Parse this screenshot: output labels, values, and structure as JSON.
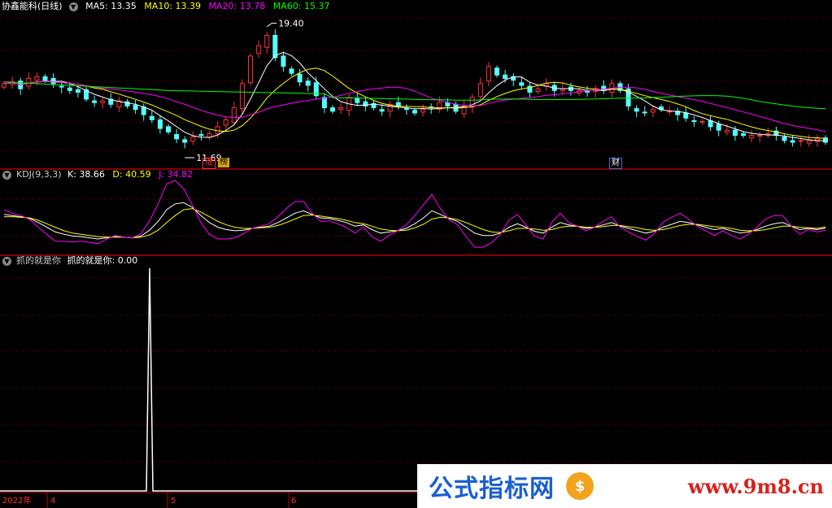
{
  "header_main": {
    "title": "协鑫能科(日线)",
    "ma5": "MA5: 13.35",
    "ma10": "MA10: 13.39",
    "ma20": "MA20: 13.78",
    "ma60": "MA60: 15.37"
  },
  "header_kdj": {
    "title": "KDJ(9,3,3)",
    "k": "K: 38.66",
    "d": "D: 40.59",
    "j": "J: 34.82"
  },
  "header_ind": {
    "title": "抓的就是你",
    "value": "抓的就是你: 0.00"
  },
  "annotations": {
    "high": "19.40",
    "low": "11.69",
    "badge_zhang": "涨",
    "badge_bang": "榜",
    "badge_cai": "财"
  },
  "x_axis": {
    "year": "2022年",
    "m4": "4",
    "m5": "5",
    "m6": "6"
  },
  "watermark": {
    "left": "公式指标网",
    "right": "www.9m8.cn",
    "logo": "$"
  },
  "colors": {
    "up": "#ff3232",
    "down": "#54ffff",
    "ma5": "#ffffff",
    "ma10": "#ffff00",
    "ma20": "#ff00ff",
    "ma60": "#00ff00",
    "grid": "#8b0000"
  },
  "chart_data": [
    {
      "type": "candlestick",
      "title": "协鑫能科(日线)",
      "price_high": 19.4,
      "price_low": 11.69,
      "close": [
        15.6,
        15.7,
        15.3,
        15.9,
        16.0,
        15.8,
        15.6,
        15.4,
        15.2,
        15.1,
        14.7,
        14.5,
        14.6,
        14.4,
        14.6,
        14.3,
        14.1,
        13.8,
        13.5,
        13.0,
        12.8,
        12.4,
        12.2,
        12.5,
        12.6,
        12.7,
        13.1,
        13.5,
        14.2,
        15.6,
        17.2,
        17.8,
        18.4,
        17.1,
        16.6,
        16.2,
        15.7,
        15.5,
        14.9,
        14.2,
        14.0,
        14.2,
        14.8,
        14.5,
        14.3,
        14.2,
        14.0,
        14.4,
        14.3,
        14.1,
        13.9,
        14.1,
        14.2,
        14.5,
        14.3,
        14.0,
        14.3,
        14.8,
        15.6,
        16.6,
        16.1,
        15.9,
        15.8,
        15.5,
        15.1,
        15.3,
        15.6,
        15.2,
        15.3,
        15.2,
        15.2,
        15.1,
        15.3,
        15.2,
        15.6,
        15.2,
        14.3,
        14.0,
        13.9,
        14.1,
        14.1,
        14.0,
        13.8,
        13.6,
        13.4,
        13.4,
        13.1,
        12.9,
        12.9,
        12.6,
        12.6,
        12.6,
        12.6,
        12.7,
        12.6,
        12.3,
        12.2,
        12.3,
        12.3,
        12.4,
        12.2
      ],
      "ma_labels": [
        "MA5",
        "MA10",
        "MA20",
        "MA60"
      ],
      "ma_values": [
        13.35,
        13.39,
        13.78,
        15.37
      ]
    },
    {
      "type": "line",
      "title": "KDJ(9,3,3)",
      "series": [
        {
          "name": "K",
          "values": [
            62,
            60,
            58,
            55,
            48,
            40,
            32,
            28,
            25,
            24,
            22,
            20,
            22,
            24,
            23,
            22,
            25,
            35,
            50,
            70,
            80,
            82,
            74,
            60,
            48,
            40,
            36,
            34,
            35,
            38,
            40,
            42,
            48,
            56,
            64,
            68,
            62,
            56,
            55,
            52,
            48,
            42,
            44,
            36,
            30,
            32,
            34,
            38,
            46,
            56,
            68,
            62,
            55,
            50,
            40,
            30,
            26,
            26,
            30,
            40,
            46,
            40,
            33,
            30,
            40,
            48,
            44,
            42,
            38,
            40,
            44,
            48,
            42,
            38,
            34,
            30,
            33,
            40,
            45,
            50,
            48,
            44,
            40,
            36,
            38,
            34,
            30,
            32,
            36,
            42,
            46,
            48,
            42,
            36,
            38,
            36,
            38.66
          ]
        },
        {
          "name": "D",
          "values": [
            58,
            58,
            57,
            56,
            52,
            46,
            40,
            34,
            30,
            28,
            26,
            24,
            23,
            23,
            23,
            22,
            23,
            27,
            35,
            48,
            60,
            70,
            72,
            66,
            58,
            50,
            44,
            40,
            38,
            38,
            39,
            40,
            43,
            48,
            54,
            60,
            61,
            59,
            57,
            55,
            52,
            48,
            46,
            42,
            37,
            35,
            34,
            35,
            39,
            45,
            54,
            57,
            56,
            53,
            48,
            42,
            36,
            32,
            31,
            34,
            38,
            38,
            37,
            35,
            36,
            40,
            42,
            42,
            40,
            40,
            41,
            43,
            43,
            41,
            39,
            36,
            35,
            36,
            39,
            43,
            45,
            45,
            43,
            41,
            40,
            38,
            35,
            34,
            34,
            36,
            39,
            42,
            42,
            40,
            39,
            38,
            40.59
          ]
        },
        {
          "name": "J",
          "values": [
            70,
            64,
            60,
            53,
            40,
            28,
            16,
            16,
            15,
            16,
            14,
            12,
            20,
            26,
            23,
            22,
            29,
            51,
            80,
            114,
            120,
            106,
            78,
            48,
            28,
            20,
            20,
            22,
            29,
            38,
            42,
            46,
            58,
            72,
            84,
            84,
            64,
            50,
            51,
            46,
            40,
            30,
            40,
            24,
            16,
            26,
            34,
            44,
            60,
            78,
            96,
            72,
            53,
            44,
            24,
            6,
            6,
            14,
            28,
            52,
            62,
            44,
            25,
            20,
            48,
            64,
            48,
            42,
            34,
            40,
            50,
            58,
            40,
            32,
            24,
            18,
            29,
            48,
            57,
            64,
            54,
            42,
            34,
            26,
            34,
            26,
            20,
            28,
            40,
            54,
            60,
            60,
            42,
            28,
            36,
            32,
            34.82
          ]
        }
      ]
    },
    {
      "type": "line",
      "title": "抓的就是你",
      "series": [
        {
          "name": "抓的就是你",
          "values": [
            0,
            0,
            0,
            0,
            0,
            0,
            0,
            0,
            0,
            0,
            0,
            0,
            0,
            0,
            0,
            0,
            0,
            0,
            0,
            0,
            0,
            0,
            0,
            1,
            0,
            0,
            0,
            0,
            0,
            0,
            0,
            0,
            0,
            0,
            0,
            0,
            0,
            0,
            0,
            0,
            0,
            0,
            0,
            0,
            0,
            0,
            0,
            0,
            0,
            0,
            0,
            0,
            0,
            0,
            0,
            0,
            0,
            0,
            0,
            0,
            0,
            0,
            0,
            0,
            0,
            0,
            0,
            0,
            0,
            0,
            0,
            0,
            0,
            0,
            0,
            0,
            0,
            0,
            0,
            0,
            0,
            0,
            0,
            0,
            0,
            0,
            0,
            0,
            0,
            0,
            0,
            0,
            0,
            0,
            0,
            0,
            0
          ]
        }
      ],
      "last_value": 0.0
    }
  ]
}
